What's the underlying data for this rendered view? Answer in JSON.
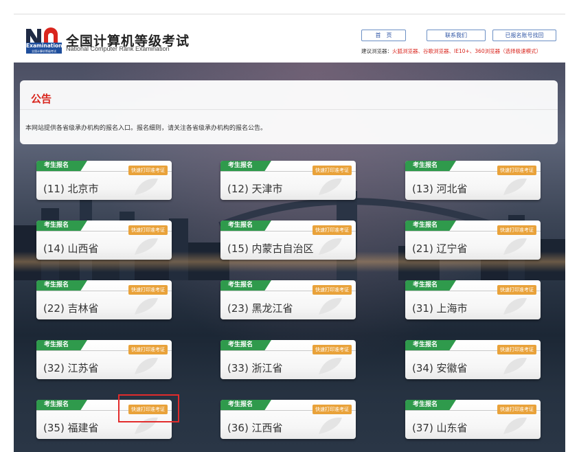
{
  "header": {
    "logo_exam_text": "Examination",
    "logo_exam_sub": "全国计算机等级考试",
    "title": "全国计算机等级考试",
    "subtitle": "National Computer Rank Examination",
    "nav": {
      "home": "首　页",
      "contact": "联系我们",
      "recover": "已报名账号找回"
    },
    "browser_hint_prefix": "建议浏览器：",
    "browser_hint_list": "火狐浏览器、谷歌浏览器、IE10+、360浏览器（选择极速模式）"
  },
  "notice": {
    "title": "公告",
    "text": "本网站提供各省级承办机构的报名入口。报名细则，请关注各省级承办机构的报名公告。"
  },
  "card_tag": "考生报名",
  "card_quick": "快速打印准考证",
  "provinces": [
    "(11) 北京市",
    "(12) 天津市",
    "(13) 河北省",
    "(14) 山西省",
    "(15) 内蒙古自治区",
    "(21) 辽宁省",
    "(22) 吉林省",
    "(23) 黑龙江省",
    "(31) 上海市",
    "(32) 江苏省",
    "(33) 浙江省",
    "(34) 安徽省",
    "(35) 福建省",
    "(36) 江西省",
    "(37) 山东省"
  ],
  "colors": {
    "tag_green": "#2f9a4c",
    "quick_orange": "#e9a23a",
    "notice_red": "#d9251d",
    "highlight_red": "#e22b2b"
  }
}
